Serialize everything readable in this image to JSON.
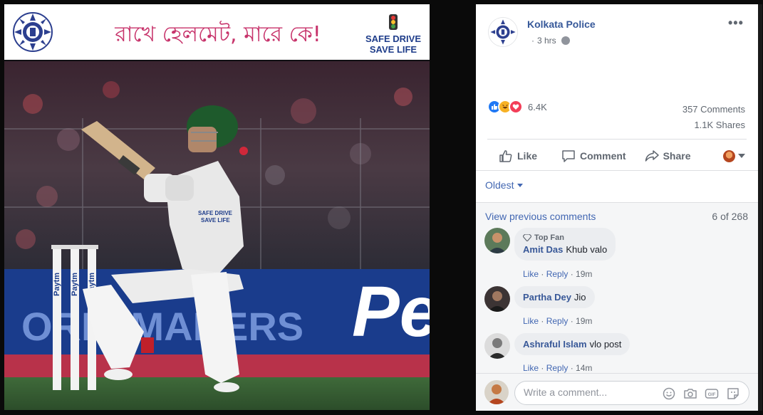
{
  "banner": {
    "slogan": "রাখে হেলমেট, মারে কে!",
    "safe_line1": "SAFE DRIVE",
    "safe_line2": "SAVE LIFE"
  },
  "photo": {
    "sponsor": "Pe",
    "board_text": "ORIA MAKERS",
    "stump_brand": "Paytm",
    "shirt_text_1": "SAFE DRIVE",
    "shirt_text_2": "SAVE LIFE"
  },
  "post": {
    "page_name": "Kolkata Police",
    "time": "3 hrs",
    "menu": "•••",
    "reaction_count": "6.4K",
    "comments_count": "357 Comments",
    "shares_count": "1.1K Shares",
    "reaction_icons": [
      "like-icon",
      "haha-icon",
      "love-icon"
    ]
  },
  "actions": {
    "like": "Like",
    "comment": "Comment",
    "share": "Share"
  },
  "comments": {
    "order": "Oldest",
    "view_previous": "View previous comments",
    "page_count": "6 of 268",
    "items": [
      {
        "badge": "Top Fan",
        "name": "Amit Das",
        "text": "Khub valo",
        "like": "Like",
        "reply": "Reply",
        "time": "19m"
      },
      {
        "name": "Partha Dey",
        "text": "Jio",
        "like": "Like",
        "reply": "Reply",
        "time": "19m"
      },
      {
        "name": "Ashraful Islam",
        "text": "vlo post",
        "like": "Like",
        "reply": "Reply",
        "time": "14m"
      }
    ]
  },
  "composer": {
    "placeholder": "Write a comment..."
  },
  "colors": {
    "link": "#4267b2",
    "name": "#385898",
    "slogan": "#c7336b",
    "safe_drive": "#1f3d8a",
    "pitch_board": "#1a3c8c"
  }
}
